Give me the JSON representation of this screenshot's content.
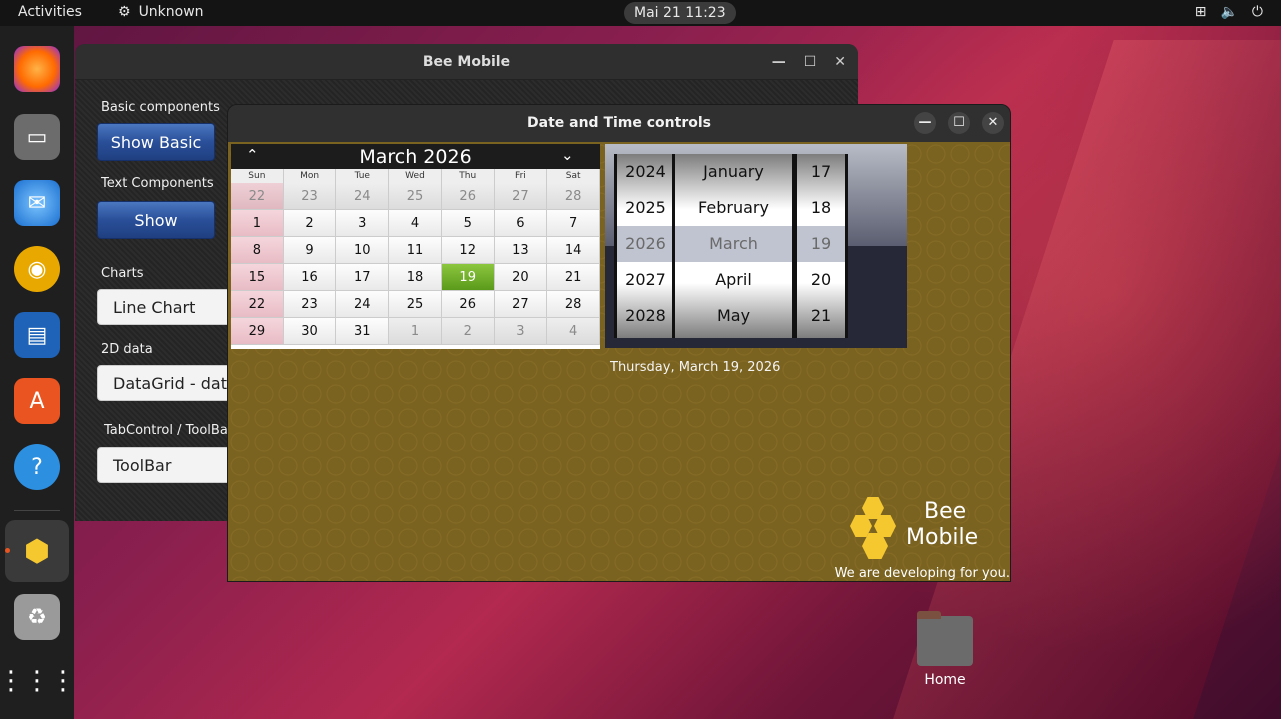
{
  "topbar": {
    "activities": "Activities",
    "app_name": "Unknown",
    "clock": "Mai 21  11:23"
  },
  "dock": {
    "items": [
      "firefox-icon",
      "files-icon",
      "thunderbird-icon",
      "rhythmbox-icon",
      "writer-icon",
      "app-center-icon",
      "help-icon",
      "bee-mobile-icon",
      "trash-icon",
      "show-apps-icon"
    ]
  },
  "bee_window": {
    "title": "Bee Mobile",
    "sections": [
      {
        "label": "Basic components",
        "button": "Show Basic"
      },
      {
        "label": "Text Components",
        "button": "Show"
      },
      {
        "label": "Charts",
        "button": "Line Chart"
      },
      {
        "label": "2D data",
        "button": "DataGrid - data"
      },
      {
        "label": "TabControl / ToolBa",
        "button": "ToolBar"
      }
    ]
  },
  "dt_window": {
    "title": "Date and Time controls",
    "calendar": {
      "month_label": "March 2026",
      "prev": "^",
      "next": "v",
      "weekdays": [
        "Sun",
        "Mon",
        "Tue",
        "Wed",
        "Thu",
        "Fri",
        "Sat"
      ],
      "weeks": [
        [
          "22",
          "23",
          "24",
          "25",
          "26",
          "27",
          "28"
        ],
        [
          "1",
          "2",
          "3",
          "4",
          "5",
          "6",
          "7"
        ],
        [
          "8",
          "9",
          "10",
          "11",
          "12",
          "13",
          "14"
        ],
        [
          "15",
          "16",
          "17",
          "18",
          "19",
          "20",
          "21"
        ],
        [
          "22",
          "23",
          "24",
          "25",
          "26",
          "27",
          "28"
        ],
        [
          "29",
          "30",
          "31",
          "1",
          "2",
          "3",
          "4"
        ]
      ],
      "selected": "19"
    },
    "spinner": {
      "years": [
        "2024",
        "2025",
        "2026",
        "2027",
        "2028"
      ],
      "months": [
        "January",
        "February",
        "March",
        "April",
        "May"
      ],
      "days": [
        "17",
        "18",
        "19",
        "20",
        "21"
      ]
    },
    "date_text": "Thursday, March 19, 2026",
    "logo_line1": "Bee",
    "logo_line2": "Mobile",
    "tagline": "We are developing for you."
  },
  "desktop": {
    "home_label": "Home"
  }
}
